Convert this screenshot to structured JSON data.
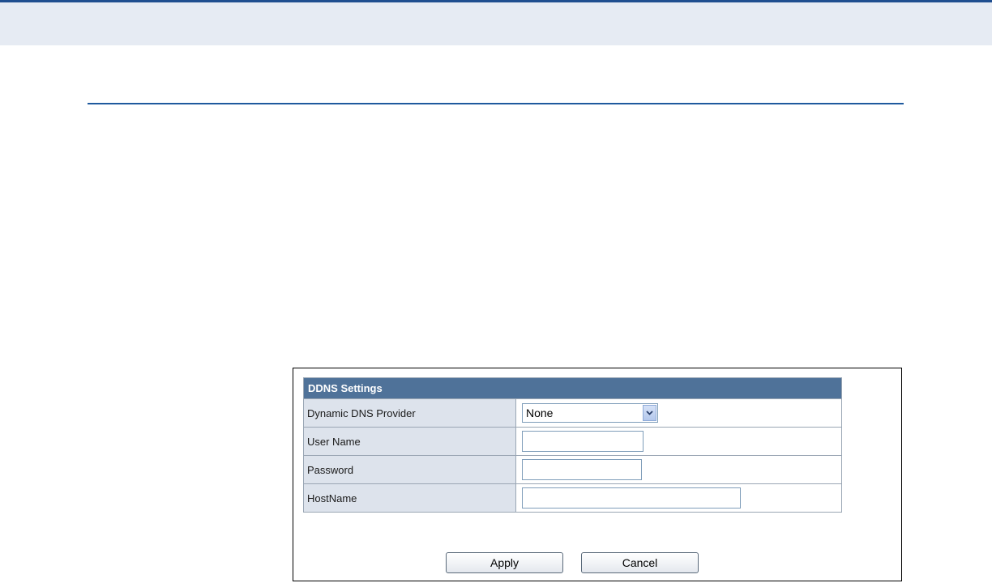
{
  "ddns": {
    "section_title": "DDNS Settings",
    "rows": [
      {
        "label": "Dynamic DNS Provider",
        "control": "select",
        "value": "None"
      },
      {
        "label": "User Name",
        "control": "text",
        "value": ""
      },
      {
        "label": "Password",
        "control": "password",
        "value": ""
      },
      {
        "label": "HostName",
        "control": "text",
        "value": ""
      }
    ],
    "buttons": {
      "apply_label": "Apply",
      "cancel_label": "Cancel"
    }
  },
  "colors": {
    "top_stripe": "#1f4e8f",
    "top_band": "#e6ebf3",
    "section_rule": "#1f5a9e",
    "table_header_bg": "#4f7299",
    "label_cell_bg": "#dde3ec"
  },
  "icons": {
    "select_arrow": "chevron-down-icon"
  }
}
